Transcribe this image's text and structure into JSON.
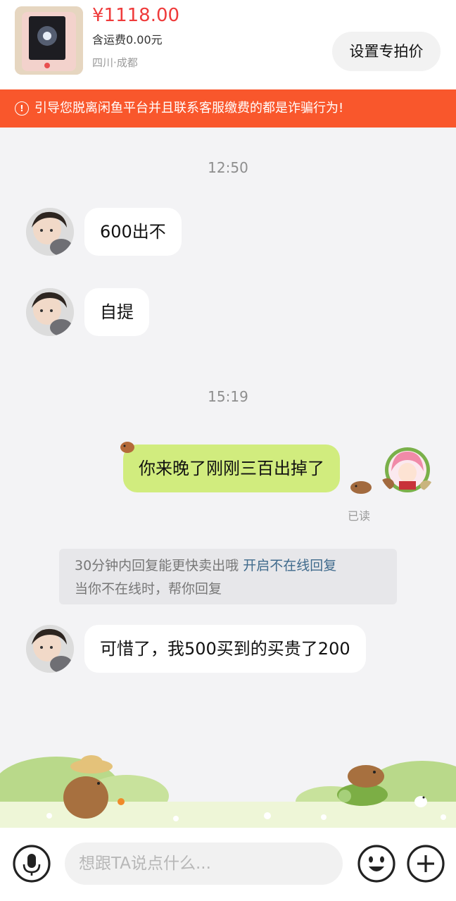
{
  "product": {
    "price": "¥1118.00",
    "shipping": "含运费0.00元",
    "location": "四川·成都",
    "special_price_button": "设置专拍价"
  },
  "warning": {
    "icon": "!",
    "text": "引导您脱离闲鱼平台并且联系客服缴费的都是诈骗行为!"
  },
  "messages": {
    "time_1": "12:50",
    "msg_1": "600出不",
    "msg_2": "自提",
    "time_2": "15:19",
    "msg_3": "你来晚了刚刚三百出掉了",
    "read_status": "已读",
    "msg_4": "可惜了，我500买到的买贵了200"
  },
  "tip": {
    "line1_text": "30分钟内回复能更快卖出哦 ",
    "line1_link": "开启不在线回复",
    "line2_text": "当你不在线时，帮你回复"
  },
  "input_bar": {
    "placeholder": "想跟TA说点什么...",
    "icons": [
      "microphone-icon",
      "emoji-icon",
      "plus-icon"
    ]
  },
  "colors": {
    "price_red": "#ef3b3b",
    "warning_orange": "#f9572c",
    "my_bubble_green": "#d1ec7e",
    "link_blue": "#3f6a8c"
  }
}
